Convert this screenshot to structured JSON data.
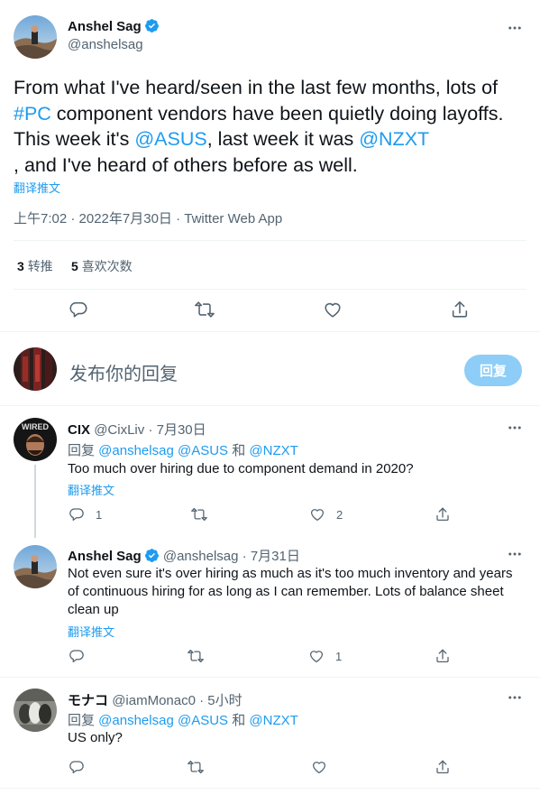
{
  "main_tweet": {
    "author_name": "Anshel Sag",
    "author_handle": "@anshelsag",
    "text_parts": [
      "From what I've heard/seen in the last few months, lots of ",
      "#PC",
      " component vendors have been quietly doing layoffs. This week it's ",
      "@ASUS",
      ", last week it was ",
      "@NZXT",
      ", and I've heard of others before as well."
    ],
    "translate": "翻译推文",
    "timestamp": "上午7:02 · 2022年7月30日 · Twitter Web App",
    "retweets_count": "3",
    "retweets_label": "转推",
    "likes_count": "5",
    "likes_label": "喜欢次数"
  },
  "compose": {
    "placeholder": "发布你的回复",
    "button_label": "回复"
  },
  "replies": [
    {
      "name": "CIX",
      "handle": "@CixLiv",
      "sep": "·",
      "date": "7月30日",
      "reply_to_prefix": "回复 ",
      "reply_to_1": "@anshelsag",
      "reply_to_2": "@ASUS",
      "reply_to_and": " 和 ",
      "reply_to_3": "@NZXT",
      "text": "Too much over hiring due to component demand in 2020?",
      "translate": "翻译推文",
      "reply_count": "1",
      "like_count": "2"
    },
    {
      "name": "Anshel Sag",
      "handle": "@anshelsag",
      "sep": "·",
      "date": "7月31日",
      "text": "Not even sure it's over hiring as much as it's too much inventory and years of continuous hiring for as long as I can remember. Lots of balance sheet clean up",
      "translate": "翻译推文",
      "like_count": "1"
    },
    {
      "name": "モナコ",
      "handle": "@iamMonac0",
      "sep": "·",
      "date": "5小时",
      "reply_to_prefix": "回复 ",
      "reply_to_1": "@anshelsag",
      "reply_to_2": "@ASUS",
      "reply_to_and": " 和 ",
      "reply_to_3": "@NZXT",
      "text": "US only?"
    }
  ],
  "icons": [
    "reply-icon",
    "retweet-icon",
    "like-icon",
    "share-icon",
    "more-icon",
    "verified-badge-icon"
  ],
  "colors": {
    "accent": "#1d9bf0",
    "text": "#0f1419",
    "muted": "#536471",
    "divider": "#eff3f4",
    "button_disabled": "#8ecdf7"
  }
}
